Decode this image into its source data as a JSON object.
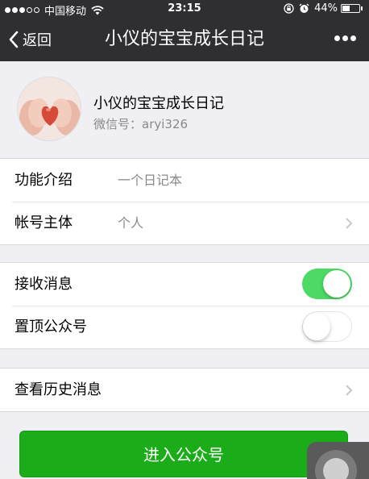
{
  "status_bar": {
    "carrier": "中国移动",
    "time": "23:15",
    "battery": "44%",
    "battery_level": 0.44,
    "signal_bars": 3,
    "signal_total": 5
  },
  "nav": {
    "back_label": "返回",
    "title": "小仪的宝宝成长日记"
  },
  "profile": {
    "name": "小仪的宝宝成长日记",
    "wechat_id": "微信号：aryi326"
  },
  "info_rows": [
    {
      "label": "功能介绍",
      "value": "一个日记本"
    },
    {
      "label": "帐号主体",
      "value": "个人"
    }
  ],
  "toggles": [
    {
      "label": "接收消息",
      "on": true
    },
    {
      "label": "置顶公众号",
      "on": false
    }
  ],
  "history": {
    "label": "查看历史消息"
  },
  "enter_button": {
    "label": "进入公众号"
  },
  "colors": {
    "nav_bg": "#2e2e33",
    "toggle_on": "#4cd964",
    "primary_button": "#1aad19"
  }
}
